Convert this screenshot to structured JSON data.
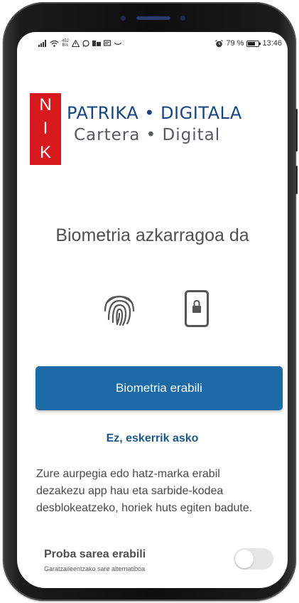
{
  "status_bar": {
    "net_speed_value": "452",
    "net_speed_unit": "B/s",
    "battery_percent": "79 %",
    "battery_level": 0.79,
    "time": "13:46"
  },
  "logo": {
    "box_letters": [
      "N",
      "I",
      "K"
    ],
    "line1": "PATRIKA • DIGITALA",
    "line2": "Cartera • Digital"
  },
  "heading": "Biometria azkarragoa da",
  "icons": {
    "fingerprint": "fingerprint-icon",
    "phone_lock": "phone-lock-icon"
  },
  "primary_button": "Biometria erabili",
  "secondary_link": "Ez, eskerrik asko",
  "description": "Zure aurpegia edo hatz-marka erabil dezakezu app hau eta sarbide-kodea desblokeatzeko, horiek huts egiten badute.",
  "test_network": {
    "title": "Proba sarea erabili",
    "subtitle": "Garatzaileentzako sare alternatiboa",
    "enabled": false
  },
  "colors": {
    "primary": "#1c6aa6",
    "link": "#1c5788",
    "logo_red": "#d7191e",
    "logo_blue": "#17457f"
  }
}
